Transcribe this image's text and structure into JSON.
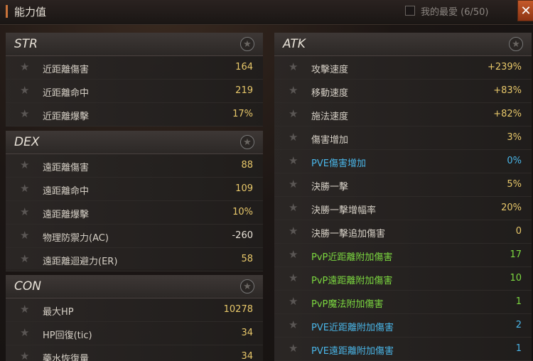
{
  "window": {
    "title": "能力值",
    "favorites_label": "我的最愛 (6/50)",
    "close_label": "✕"
  },
  "panels": [
    {
      "key": "str",
      "name": "STR",
      "rows": [
        {
          "label": "近距離傷害",
          "value": "164"
        },
        {
          "label": "近距離命中",
          "value": "219"
        },
        {
          "label": "近距離爆擊",
          "value": "17%"
        }
      ]
    },
    {
      "key": "dex",
      "name": "DEX",
      "rows": [
        {
          "label": "遠距離傷害",
          "value": "88"
        },
        {
          "label": "遠距離命中",
          "value": "109"
        },
        {
          "label": "遠距離爆擊",
          "value": "10%"
        },
        {
          "label": "物理防禦力(AC)",
          "value": "-260"
        },
        {
          "label": "遠距離迴避力(ER)",
          "value": "58"
        }
      ]
    },
    {
      "key": "con",
      "name": "CON",
      "rows": [
        {
          "label": "最大HP",
          "value": "10278"
        },
        {
          "label": "HP回復(tic)",
          "value": "34"
        },
        {
          "label": "藥水恢復量",
          "value": "34"
        }
      ]
    },
    {
      "key": "atk",
      "name": "ATK",
      "rows": [
        {
          "label": "攻擊速度",
          "value": "+239%"
        },
        {
          "label": "移動速度",
          "value": "+83%"
        },
        {
          "label": "施法速度",
          "value": "+82%"
        },
        {
          "label": "傷害增加",
          "value": "3%"
        },
        {
          "label": "PVE傷害增加",
          "value": "0%",
          "kind": "pve"
        },
        {
          "label": "決勝一擊",
          "value": "5%"
        },
        {
          "label": "決勝一擊增幅率",
          "value": "20%"
        },
        {
          "label": "決勝一擊追加傷害",
          "value": "0"
        },
        {
          "label": "PvP近距離附加傷害",
          "value": "17",
          "kind": "pvp"
        },
        {
          "label": "PvP遠距離附加傷害",
          "value": "10",
          "kind": "pvp"
        },
        {
          "label": "PvP魔法附加傷害",
          "value": "1",
          "kind": "pvp"
        },
        {
          "label": "PVE近距離附加傷害",
          "value": "2",
          "kind": "pve"
        },
        {
          "label": "PVE遠距離附加傷害",
          "value": "1",
          "kind": "pve"
        }
      ]
    }
  ],
  "colors": {
    "accent": "#c9733a",
    "value": "#e8c86a",
    "pve": "#4ab6e8",
    "pvp": "#7cd840"
  },
  "icons": {
    "favorite": "star-icon",
    "close": "close-icon"
  }
}
